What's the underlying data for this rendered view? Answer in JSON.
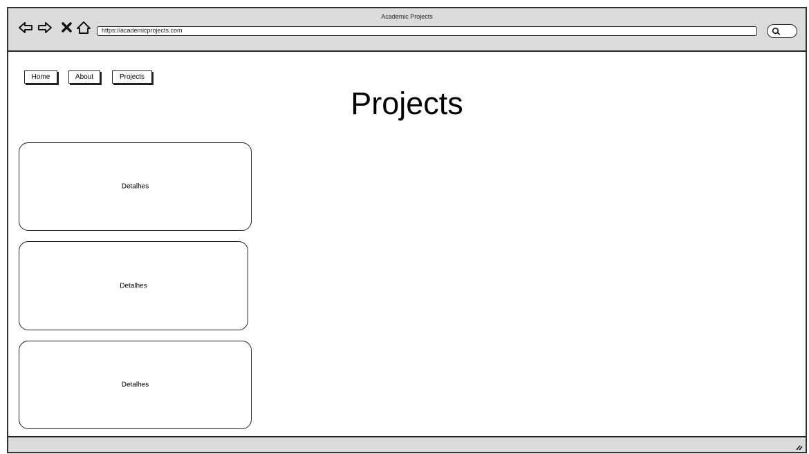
{
  "window": {
    "title": "Academic Projects"
  },
  "toolbar": {
    "back_icon": "back-arrow-icon",
    "forward_icon": "forward-arrow-icon",
    "close_icon": "close-icon",
    "home_icon": "home-icon",
    "url": "https://academicprojects.com",
    "search_icon": "search-icon"
  },
  "nav": {
    "items": [
      {
        "label": "Home"
      },
      {
        "label": "About"
      },
      {
        "label": "Projects"
      }
    ]
  },
  "main": {
    "title": "Projects",
    "cards": [
      {
        "label": "Detalhes"
      },
      {
        "label": "Detalhes"
      },
      {
        "label": "Detalhes"
      }
    ]
  }
}
